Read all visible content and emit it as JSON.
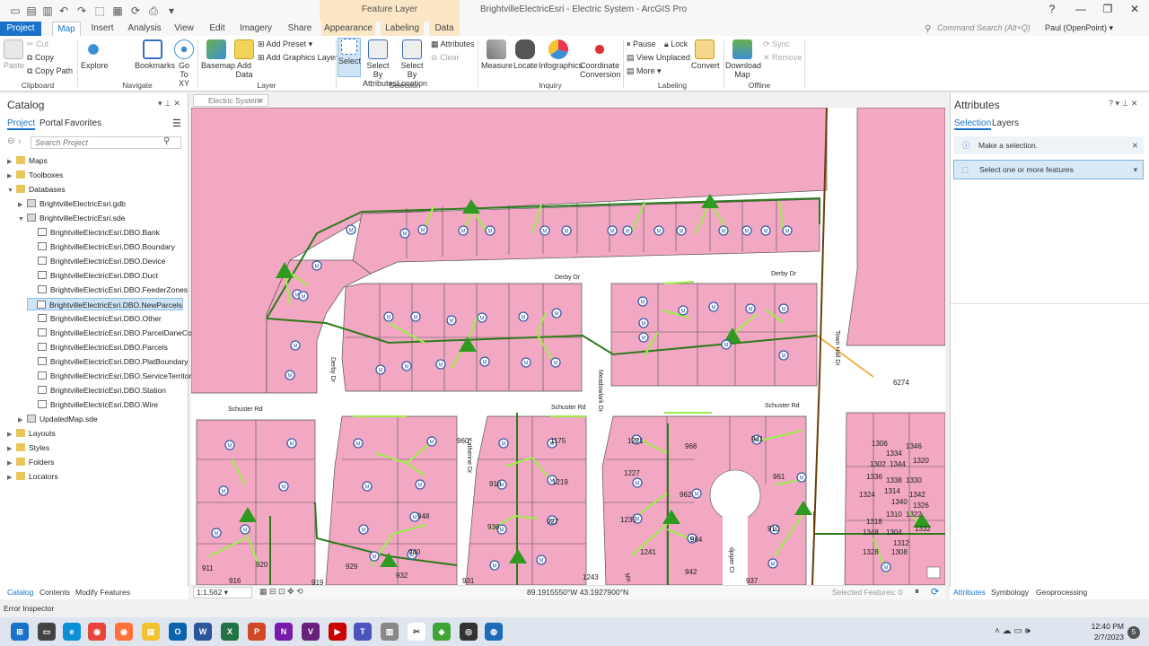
{
  "title_bar": {
    "window_title": "BrightvilleElectricEsri - Electric System - ArcGIS Pro",
    "context_tab_group": "Feature Layer",
    "help_icon": "?",
    "controls": [
      "—",
      "❐",
      "✕"
    ]
  },
  "tabs": [
    "Project",
    "Map",
    "Insert",
    "Analysis",
    "View",
    "Edit",
    "Imagery",
    "Share",
    "Appearance",
    "Labeling",
    "Data"
  ],
  "command_search": {
    "placeholder": "Command Search (Alt+Q)"
  },
  "user": "Paul (OpenPoint) ▾",
  "ribbon": {
    "clipboard": {
      "group": "Clipboard",
      "paste": "Paste",
      "cut": "Cut",
      "copy": "Copy",
      "copy_path": "Copy Path"
    },
    "navigate": {
      "group": "Navigate",
      "explore": "Explore",
      "bookmarks": "Bookmarks",
      "go_to_xy": "Go To XY"
    },
    "layer": {
      "group": "Layer",
      "basemap": "Basemap",
      "add_data": "Add Data",
      "add_preset": "Add Preset ▾",
      "add_graphics_layer": "Add Graphics Layer"
    },
    "selection": {
      "group": "Selection",
      "select": "Select",
      "select_by_attributes": "Select By Attributes",
      "select_by_location": "Select By Location",
      "attributes": "Attributes",
      "clear": "Clear"
    },
    "inquiry": {
      "group": "Inquiry",
      "measure": "Measure",
      "locate": "Locate",
      "infographics": "Infographics",
      "coordinate_conversion": "Coordinate Conversion"
    },
    "labeling": {
      "group": "Labeling",
      "pause": "Pause",
      "lock": "Lock",
      "view_unplaced": "View Unplaced",
      "more": "More ▾",
      "convert": "Convert"
    },
    "offline": {
      "group": "Offline",
      "download_map": "Download Map",
      "sync": "Sync",
      "remove": "Remove"
    }
  },
  "catalog": {
    "title": "Catalog",
    "subtabs": [
      "Project",
      "Portal",
      "Favorites"
    ],
    "search_placeholder": "Search Project",
    "tree": [
      {
        "label": "Maps",
        "level": 0,
        "arrow": "▶",
        "icon": "folder"
      },
      {
        "label": "Toolboxes",
        "level": 0,
        "arrow": "▶",
        "icon": "folder"
      },
      {
        "label": "Databases",
        "level": 0,
        "arrow": "▼",
        "icon": "folder"
      },
      {
        "label": "BrightvilleElectricEsri.gdb",
        "level": 1,
        "arrow": "▶",
        "icon": "db"
      },
      {
        "label": "BrightvilleElectricEsri.sde",
        "level": 1,
        "arrow": "▼",
        "icon": "db"
      },
      {
        "label": "BrightvilleElectricEsri.DBO.Bank",
        "level": 2,
        "arrow": "",
        "icon": "fc"
      },
      {
        "label": "BrightvilleElectricEsri.DBO.Boundary",
        "level": 2,
        "arrow": "",
        "icon": "fc"
      },
      {
        "label": "BrightvilleElectricEsri.DBO.Device",
        "level": 2,
        "arrow": "",
        "icon": "fc"
      },
      {
        "label": "BrightvilleElectricEsri.DBO.Duct",
        "level": 2,
        "arrow": "",
        "icon": "fc"
      },
      {
        "label": "BrightvilleElectricEsri.DBO.FeederZones",
        "level": 2,
        "arrow": "",
        "icon": "fc"
      },
      {
        "label": "BrightvilleElectricEsri.DBO.NewParcels",
        "level": 2,
        "arrow": "",
        "icon": "fc",
        "selected": true
      },
      {
        "label": "BrightvilleElectricEsri.DBO.Other",
        "level": 2,
        "arrow": "",
        "icon": "fc"
      },
      {
        "label": "BrightvilleElectricEsri.DBO.ParcelDaneCou",
        "level": 2,
        "arrow": "",
        "icon": "fc"
      },
      {
        "label": "BrightvilleElectricEsri.DBO.Parcels",
        "level": 2,
        "arrow": "",
        "icon": "fc"
      },
      {
        "label": "BrightvilleElectricEsri.DBO.PlatBoundary",
        "level": 2,
        "arrow": "",
        "icon": "fc"
      },
      {
        "label": "BrightvilleElectricEsri.DBO.ServiceTerritory",
        "level": 2,
        "arrow": "",
        "icon": "fc"
      },
      {
        "label": "BrightvilleElectricEsri.DBO.Station",
        "level": 2,
        "arrow": "",
        "icon": "fc"
      },
      {
        "label": "BrightvilleElectricEsri.DBO.Wire",
        "level": 2,
        "arrow": "",
        "icon": "fc"
      },
      {
        "label": "UpdatedMap.sde",
        "level": 1,
        "arrow": "▶",
        "icon": "db"
      },
      {
        "label": "Layouts",
        "level": 0,
        "arrow": "▶",
        "icon": "folder"
      },
      {
        "label": "Styles",
        "level": 0,
        "arrow": "▶",
        "icon": "folder"
      },
      {
        "label": "Folders",
        "level": 0,
        "arrow": "▶",
        "icon": "folder"
      },
      {
        "label": "Locators",
        "level": 0,
        "arrow": "▶",
        "icon": "folder"
      }
    ],
    "bottom_tabs": [
      "Catalog",
      "Contents",
      "Modify Features"
    ]
  },
  "map": {
    "tab_label": "Electric System",
    "streets": {
      "derby_dr": "Derby Dr",
      "schuster_rd": "Schuster Rd",
      "meadowlark_dr": "Meadowlark Dr",
      "katherine_dr": "Katherine Dr",
      "town_hall_dr": "Town Hall Dr",
      "sandpiper_ct": "dpiper Ct",
      "me_partial": "Me"
    },
    "meter_symbol": "M",
    "parcel_numbers": {
      "n6274": "6274",
      "n1306": "1306",
      "n1346": "1346",
      "n1334": "1334",
      "n1302": "1302",
      "n1344": "1344",
      "n1320": "1320",
      "n1336": "1336",
      "n1338": "1338",
      "n1330": "1330",
      "n1324": "1324",
      "n1314": "1314",
      "n1342": "1342",
      "n1310": "1310",
      "n1326": "1326",
      "n1318": "1318",
      "n1322": "1322",
      "n1348": "1348",
      "n1304": "1304",
      "n1312": "1312",
      "n1328": "1328",
      "n1308": "1308",
      "n1332": "1332",
      "n1340": "1340",
      "n1175": "1175",
      "n1219": "1219",
      "n927": "927",
      "n948": "948",
      "n940": "940",
      "n932": "932",
      "n929": "929",
      "n931": "931",
      "n1243": "1243",
      "n1221": "1221",
      "n1227": "1227",
      "n1235": "1235",
      "n1241": "1241",
      "n968": "968",
      "n962": "962",
      "n964": "964",
      "n942": "942",
      "n937": "937",
      "n910": "910",
      "n919": "919",
      "n911": "911",
      "n920": "920",
      "n916": "916",
      "n961": "961",
      "n941": "941",
      "n960": "960",
      "n918": "918",
      "n936": "936"
    },
    "scale": "1:1,562",
    "coordinates": "89.1915550°W 43.1927900°N",
    "selected_features": "Selected Features: 0"
  },
  "attributes_pane": {
    "title": "Attributes",
    "subtabs": [
      "Selection",
      "Layers"
    ],
    "info_message": "Make a selection.",
    "dropdown": "Select one or more features",
    "bottom_tabs": [
      "Attributes",
      "Symbology",
      "Geoprocessing"
    ]
  },
  "status_bar": "Error Inspector",
  "taskbar": {
    "time": "12:40 PM",
    "date": "2/7/2023",
    "notification_count": "5"
  },
  "colors": {
    "parcel_fill": "#f2a7c2",
    "parcel_stroke": "#555555",
    "wire_dark": "#2d7a1a",
    "wire_light": "#9cf04a",
    "transformer": "#2e9a1f",
    "meter": "#3b5ba8",
    "accent": "#1a73c8"
  }
}
